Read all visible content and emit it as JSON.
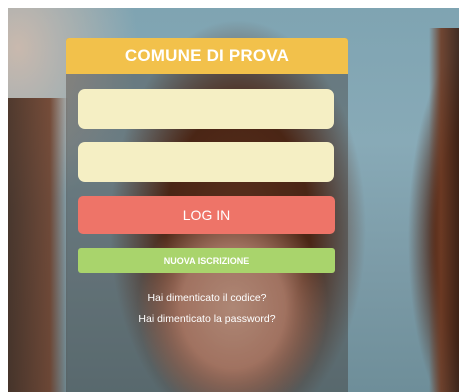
{
  "app": {
    "title": "COMUNE DI PROVA"
  },
  "login_form": {
    "code_field": {
      "value": "",
      "placeholder": ""
    },
    "password_field": {
      "value": "",
      "placeholder": ""
    },
    "login_button_label": "LOG IN",
    "register_button_label": "NUOVA ISCRIZIONE",
    "forgot_code_link": "Hai dimenticato il codice?",
    "forgot_password_link": "Hai dimenticato la password?"
  },
  "colors": {
    "header": "#f2c14b",
    "field_background": "#f5efc4",
    "login_button": "#ee7468",
    "register_button": "#a9d46c"
  }
}
